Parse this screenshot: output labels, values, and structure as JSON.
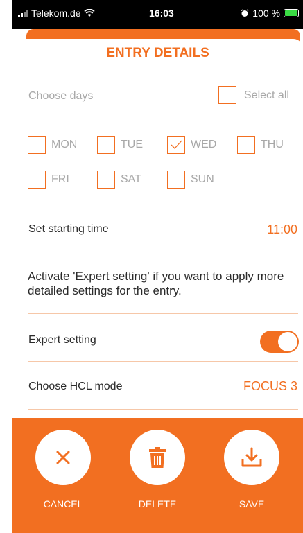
{
  "status_bar": {
    "carrier": "Telekom.de",
    "time": "16:03",
    "battery": "100 %"
  },
  "title": "ENTRY DETAILS",
  "days": {
    "choose_label": "Choose days",
    "select_all_label": "Select all",
    "select_all_checked": false,
    "items": [
      {
        "label": "MON",
        "checked": false
      },
      {
        "label": "TUE",
        "checked": false
      },
      {
        "label": "WED",
        "checked": true
      },
      {
        "label": "THU",
        "checked": false
      },
      {
        "label": "FRI",
        "checked": false
      },
      {
        "label": "SAT",
        "checked": false
      },
      {
        "label": "SUN",
        "checked": false
      }
    ]
  },
  "start_time": {
    "label": "Set starting time",
    "value": "11:00"
  },
  "expert_info": "Activate 'Expert setting' if you want to apply more detailed settings for the entry.",
  "expert_setting": {
    "label": "Expert setting",
    "enabled": true
  },
  "hcl_mode": {
    "label": "Choose HCL mode",
    "value": "FOCUS 3"
  },
  "actions": {
    "cancel": "CANCEL",
    "delete": "DELETE",
    "save": "SAVE"
  },
  "colors": {
    "accent": "#f26f21",
    "muted_text": "#a8a8a8",
    "divider": "#f6c7a8"
  },
  "icons": {
    "cancel": "close-icon",
    "delete": "trash-icon",
    "save": "download-tray-icon"
  }
}
